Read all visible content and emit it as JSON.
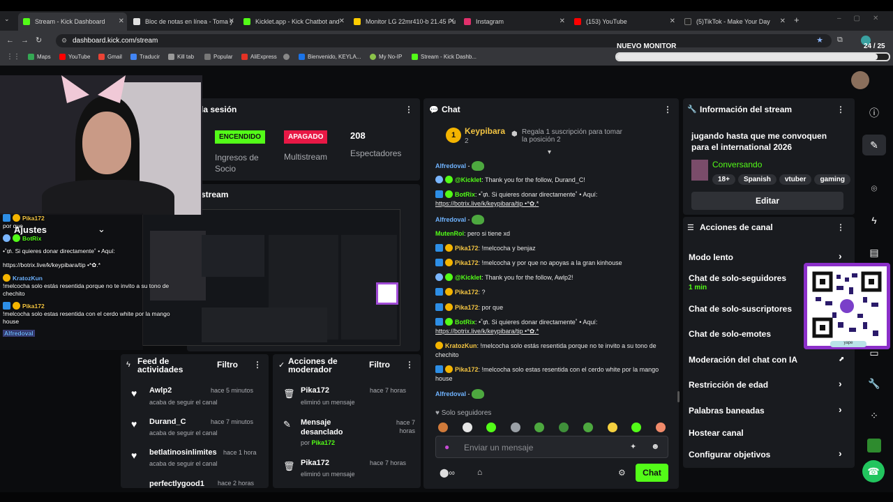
{
  "browser": {
    "tabs": [
      {
        "label": "Stream - Kick Dashboard",
        "active": true,
        "color": "#53fc18"
      },
      {
        "label": "Bloc de notas en línea - Toma y",
        "active": false,
        "color": "#f0f0f0"
      },
      {
        "label": "Kicklet.app - Kick Chatbot and",
        "active": false,
        "color": "#53fc18"
      },
      {
        "label": "Monitor LG 22mr410-b 21.45 Pu",
        "active": false,
        "color": "#ffcc00"
      },
      {
        "label": "Instagram",
        "active": false,
        "color": "#e1306c"
      },
      {
        "label": "(153) YouTube",
        "active": false,
        "color": "#ff0000"
      },
      {
        "label": "(5)TikTok - Make Your Day",
        "active": false,
        "color": "#111111"
      }
    ],
    "url": "dashboard.kick.com/stream",
    "bookmarks": [
      "Maps",
      "YouTube",
      "Gmail",
      "Traducir",
      "Kill tab",
      "Popular",
      "AliExpress",
      "",
      "Bienvenido, KEYLA...",
      "My No-IP",
      "Stream - Kick Dashb..."
    ]
  },
  "goal": {
    "title": "NUEVO MONITOR",
    "current": "24",
    "target": "/ 25",
    "progress": 0.96
  },
  "session": {
    "title": "la sesión",
    "socio_status": "ENCENDIDO",
    "socio_label": "Ingresos de Socio",
    "multistream_status": "APAGADO",
    "multistream_label": "Multistream",
    "viewers": "208",
    "viewers_label": "Espectadores"
  },
  "stream_header": "stream",
  "overlay": {
    "settings_label": "Ajustes",
    "lines": [
      {
        "user": "Pika172",
        "text": "por que"
      },
      {
        "user": "BotRix",
        "text": "•˚₥. Si quieres donar directamente˚ • Aquí:"
      },
      {
        "user": "",
        "text": "https://botrix.live/k/keypibara/tip •*✿.*"
      },
      {
        "user": "KratozKun",
        "text": "!melcocha solo estás resentida porque no te invito a su tono de chechito"
      },
      {
        "user": "Pika172",
        "text": "!melcocha solo estas resentida con el cerdo white por la mango house"
      },
      {
        "user": "Alfredoval",
        "text": ""
      }
    ]
  },
  "chat": {
    "title": "Chat",
    "pinned_user": "Keypibara",
    "pinned_count": "2",
    "gift_text": "Regala 1 suscripción para tomar la posición 2",
    "messages": [
      {
        "user": "Alfredoval",
        "text": "",
        "color": "u-blue"
      },
      {
        "user": "@Kicklet",
        "text": "Thank you for the follow, Durand_C!",
        "color": "u-green"
      },
      {
        "user": "BotRix",
        "text": "•˚₥. Si quieres donar directamente˚ • Aquí:",
        "color": "u-green"
      },
      {
        "user": "",
        "text": "https://botrix.live/k/keypibara/tip •*✿.*",
        "color": ""
      },
      {
        "user": "Alfredoval",
        "text": "",
        "color": "u-blue"
      },
      {
        "user": "MutenRoi",
        "text": "pero si tiene xd",
        "color": "u-green"
      },
      {
        "user": "Pika172",
        "text": "!melcocha y benjaz",
        "color": "u-gold"
      },
      {
        "user": "Pika172",
        "text": "!melcocha y por que no apoyas a la gran kinhouse",
        "color": "u-gold"
      },
      {
        "user": "@Kicklet",
        "text": "Thank you for the follow, Awlp2!",
        "color": "u-green"
      },
      {
        "user": "Pika172",
        "text": "?",
        "color": "u-gold"
      },
      {
        "user": "Pika172",
        "text": "por que",
        "color": "u-gold"
      },
      {
        "user": "BotRix",
        "text": "•˚₥. Si quieres donar directamente˚ • Aquí:",
        "color": "u-green"
      },
      {
        "user": "",
        "text": "https://botrix.live/k/keypibara/tip •*✿.*",
        "color": ""
      },
      {
        "user": "KratozKun",
        "text": "!melcocha solo estás resentida porque no te invito a su tono de chechito",
        "color": "u-gold"
      },
      {
        "user": "Pika172",
        "text": "!melcocha solo estas resentida con el cerdo white por la mango house",
        "color": "u-gold"
      },
      {
        "user": "Alfredoval",
        "text": "",
        "color": "u-blue"
      }
    ],
    "mode_label": "Solo seguidores",
    "input_placeholder": "Enviar un mensaje",
    "send_label": "Chat"
  },
  "stream_info": {
    "title": "Información del stream",
    "stream_title": "jugando hasta que me convoquen para el international 2026",
    "category": "Conversando",
    "tags": [
      "18+",
      "Spanish",
      "vtuber",
      "gaming"
    ],
    "edit_label": "Editar"
  },
  "channel_actions": {
    "title": "Acciones de canal",
    "items": [
      {
        "label": "Modo lento",
        "sub": ""
      },
      {
        "label": "Chat de solo-seguidores",
        "sub": "1 min"
      },
      {
        "label": "Chat de solo-suscriptores",
        "sub": ""
      },
      {
        "label": "Chat de solo-emotes",
        "sub": ""
      },
      {
        "label": "Moderación del chat con IA",
        "sub": ""
      },
      {
        "label": "Restricción de edad",
        "sub": ""
      },
      {
        "label": "Palabras baneadas",
        "sub": ""
      },
      {
        "label": "Hostear canal",
        "sub": ""
      },
      {
        "label": "Configurar objetivos",
        "sub": ""
      }
    ]
  },
  "activity": {
    "title": "Feed de actividades",
    "filter_label": "Filtro",
    "items": [
      {
        "name": "Awlp2",
        "time": "hace 5 minutos",
        "sub": "acaba de seguir el canal"
      },
      {
        "name": "Durand_C",
        "time": "hace 7 minutos",
        "sub": "acaba de seguir el canal"
      },
      {
        "name": "betlatinosinlimites",
        "time": "hace 1 hora",
        "sub": "acaba de seguir el canal"
      },
      {
        "name": "perfectlygood1",
        "time": "hace 2 horas",
        "sub": ""
      }
    ]
  },
  "mod": {
    "title": "Acciones de moderador",
    "filter_label": "Filtro",
    "items": [
      {
        "name": "Pika172",
        "time": "hace 7 horas",
        "sub": "eliminó un mensaje"
      },
      {
        "name": "Mensaje desanclado",
        "time": "hace 7 horas",
        "sub": "por",
        "by": "Pika172"
      },
      {
        "name": "Pika172",
        "time": "hace 7 horas",
        "sub": "eliminó un mensaje"
      }
    ]
  },
  "qr_caption": "yape"
}
